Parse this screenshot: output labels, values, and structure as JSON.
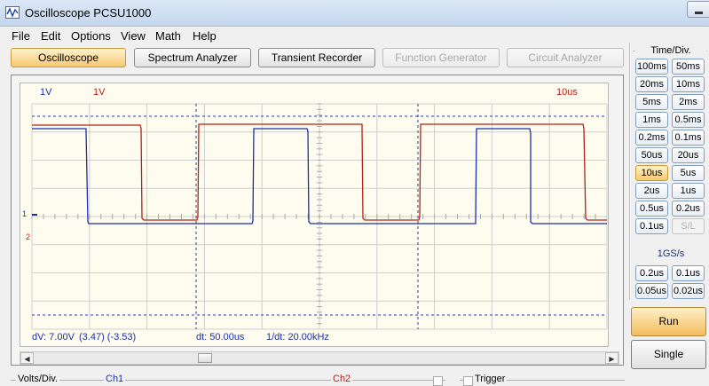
{
  "window": {
    "title": "Oscilloscope PCSU1000"
  },
  "menu": [
    "File",
    "Edit",
    "Options",
    "View",
    "Math",
    "Help"
  ],
  "tabs": [
    {
      "label": "Oscilloscope",
      "state": "active"
    },
    {
      "label": "Spectrum Analyzer",
      "state": "normal"
    },
    {
      "label": "Transient Recorder",
      "state": "normal"
    },
    {
      "label": "Function Generator",
      "state": "disabled"
    },
    {
      "label": "Circuit Analyzer",
      "state": "disabled"
    }
  ],
  "scope": {
    "ch1_scale": "1V",
    "ch2_scale": "1V",
    "timebase": "10us",
    "marker_ch1": "1",
    "marker_ch2": "2",
    "colors": {
      "ch1": "#1c2fa8",
      "ch2": "#b3221a",
      "grid": "#c8c8c8",
      "cursor": "#2b3aa5"
    }
  },
  "readouts": {
    "dv": "dV: 7.00V",
    "dv_pair": "(3.47) (-3.53)",
    "dt": "dt: 50.00us",
    "inv_dt": "1/dt: 20.00kHz"
  },
  "bottom": {
    "volts_div": "Volts/Div.",
    "ch1": "Ch1",
    "ch2": "Ch2",
    "trigger": "Trigger"
  },
  "right_panel": {
    "time_div_title": "Time/Div.",
    "time_div": [
      "100ms",
      "50ms",
      "20ms",
      "10ms",
      "5ms",
      "2ms",
      "1ms",
      "0.5ms",
      "0.2ms",
      "0.1ms",
      "50us",
      "20us",
      "10us",
      "5us",
      "2us",
      "1us",
      "0.5us",
      "0.2us",
      "0.1us",
      "S/L"
    ],
    "selected_time_div": "10us",
    "disabled_time_div": "S/L",
    "sample_rate": "1GS/s",
    "fast_div": [
      "0.2us",
      "0.1us",
      "0.05us",
      "0.02us"
    ],
    "run": "Run",
    "single": "Single"
  }
}
